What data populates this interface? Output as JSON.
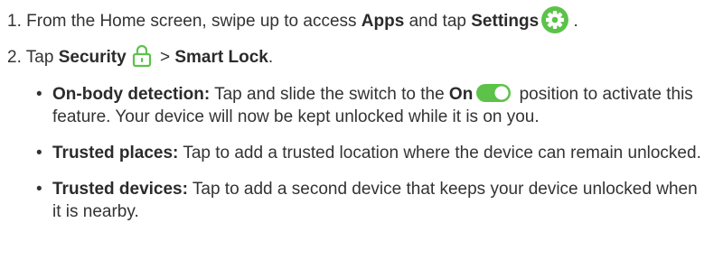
{
  "steps": [
    {
      "number": "1.",
      "text_before": "From the Home screen, swipe up to access ",
      "bold_1": "Apps",
      "text_mid": " and tap ",
      "bold_2": "Settings",
      "text_after": " .",
      "icon": "settings-gear-icon",
      "icon_color": "#5cc24a"
    },
    {
      "number": "2.",
      "text_before": "Tap ",
      "bold_1": "Security",
      "text_mid": " > ",
      "bold_2": "Smart Lock",
      "text_after": ".",
      "icon": "lock-icon",
      "icon_color": "#5cc24a"
    }
  ],
  "bullets": [
    {
      "label": "On-body detection:",
      "text_before": " Tap and slide the switch to the ",
      "bold": "On",
      "text_after": " position to activate this feature. Your device will now be kept unlocked while it is on you.",
      "icon": "toggle-switch-icon",
      "icon_color": "#5cc24a"
    },
    {
      "label": "Trusted places:",
      "text": " Tap to add a trusted location where the device can remain unlocked."
    },
    {
      "label": "Trusted devices:",
      "text": " Tap to add a second device that keeps your device unlocked when it is nearby."
    }
  ]
}
